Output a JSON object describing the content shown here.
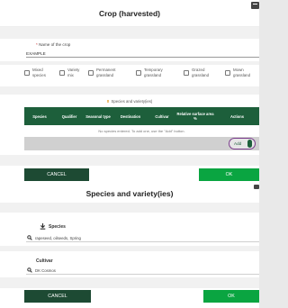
{
  "crop_dialog": {
    "title": "Crop (harvested)",
    "name_label": "Name of the crop",
    "name_required_mark": "*",
    "name_value": "EXAMPLE",
    "grassland_types": [
      "Mixed species",
      "Variety mix",
      "Permanent grassland",
      "Temporary grassland",
      "Grazed grassland",
      "Mown grassland"
    ],
    "species_section": {
      "marker": "!!",
      "title": "Species and variety(ies)",
      "columns": [
        "Species",
        "Qualifier",
        "Seasonal type",
        "Destination",
        "Cultivar",
        "Relative surface area %",
        "Actions"
      ],
      "empty_message": "No species entered. To add one, use the \"Add\" button.",
      "add_label": "Add"
    },
    "cancel_label": "CANCEL",
    "ok_label": "OK"
  },
  "species_dialog": {
    "title": "Species and variety(ies)",
    "species_label": "Species",
    "species_value": "rapeseed, oilseeds, Spring",
    "cultivar_label": "Cultivar",
    "cultivar_value": "DK Cosmos",
    "cancel_label": "CANCEL",
    "ok_label": "OK"
  },
  "colors": {
    "table_header": "#1d5f3b",
    "cancel_button": "#1d4a33",
    "ok_button": "#0aa541",
    "add_button_border": "#7a3b8c"
  }
}
